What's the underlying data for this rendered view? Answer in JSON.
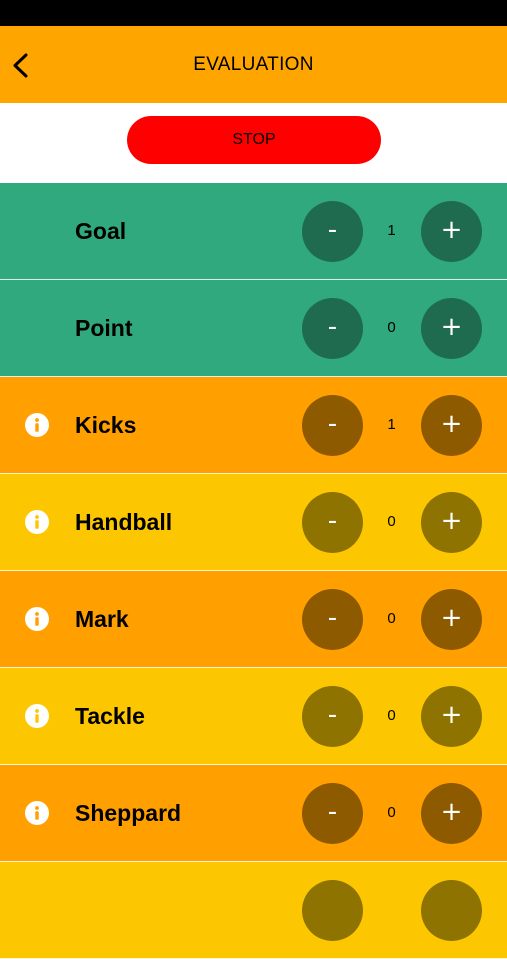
{
  "header": {
    "title": "EVALUATION"
  },
  "stop": {
    "label": "STOP"
  },
  "colors": {
    "nav": "#ffa500",
    "stop": "#ff0000",
    "green_row": "#30a97e",
    "green_btn": "#1f6b50",
    "orange_row": "#ffa000",
    "orange_btn": "#8e5a00",
    "yellow_row": "#fcc700",
    "yellow_btn": "#8f7300"
  },
  "rows": [
    {
      "label": "Goal",
      "count": "1",
      "has_info": false,
      "theme": "green"
    },
    {
      "label": "Point",
      "count": "0",
      "has_info": false,
      "theme": "green"
    },
    {
      "label": "Kicks",
      "count": "1",
      "has_info": true,
      "theme": "orange"
    },
    {
      "label": "Handball",
      "count": "0",
      "has_info": true,
      "theme": "yellow"
    },
    {
      "label": "Mark",
      "count": "0",
      "has_info": true,
      "theme": "orange"
    },
    {
      "label": "Tackle",
      "count": "0",
      "has_info": true,
      "theme": "yellow"
    },
    {
      "label": "Sheppard",
      "count": "0",
      "has_info": true,
      "theme": "orange"
    },
    {
      "label": "",
      "count": "",
      "has_info": false,
      "theme": "yellow"
    }
  ],
  "buttons": {
    "minus": "-",
    "plus": "+"
  }
}
